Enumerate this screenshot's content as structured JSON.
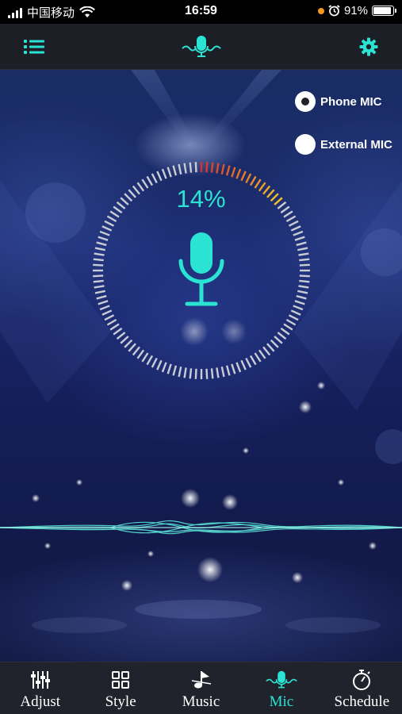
{
  "status_bar": {
    "carrier": "中国移动",
    "time": "16:59",
    "battery": "91%",
    "battery_level": 0.91
  },
  "top_nav": {
    "menu_icon": "list-icon",
    "center_icon": "microphone-wave-icon",
    "settings_icon": "gear-icon"
  },
  "mic_options": [
    {
      "label": "Phone MIC",
      "selected": true
    },
    {
      "label": "External MIC",
      "selected": false
    }
  ],
  "level": {
    "percent_text": "14%",
    "fraction": 0.14
  },
  "tabs": [
    {
      "label": "Adjust",
      "icon": "sliders-icon",
      "active": false
    },
    {
      "label": "Style",
      "icon": "grid-icon",
      "active": false
    },
    {
      "label": "Music",
      "icon": "music-note-icon",
      "active": false
    },
    {
      "label": "Mic",
      "icon": "microphone-wave-icon",
      "active": true
    },
    {
      "label": "Schedule",
      "icon": "stopwatch-icon",
      "active": false
    }
  ],
  "colors": {
    "accent": "#2be3d3",
    "nav_bg": "#1c1f26",
    "tab_bg": "#20232b",
    "level_red": "#d9322b",
    "level_yellow": "#f3c52a"
  }
}
